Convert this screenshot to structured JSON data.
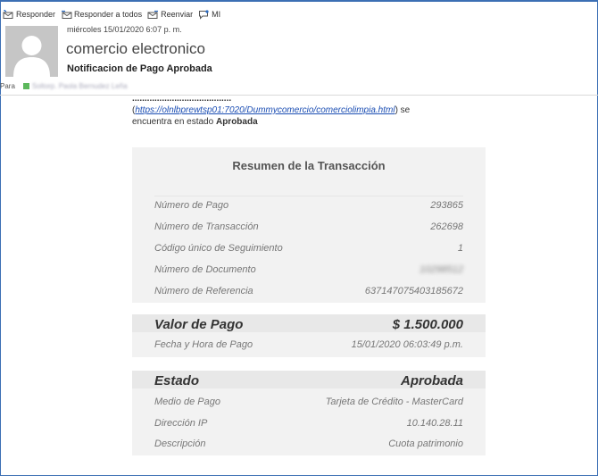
{
  "toolbar": {
    "reply": "Responder",
    "reply_all": "Responder a todos",
    "forward": "Reenviar",
    "im": "MI"
  },
  "header": {
    "date": "miércoles 15/01/2020 6:07 p. m.",
    "sender": "comercio electronico",
    "subject": "Notificacion de Pago Aprobada",
    "to_label": "Para",
    "recipient": "Soltorp. Paola Bernudez Leña"
  },
  "body": {
    "cut_text": "........................................",
    "paren_open": "(",
    "link": "https://olnlbprewtsp01:7020/Dummycomercio/comerciolimpia.html",
    "paren_close": ") se",
    "status_prefix": "encuentra en estado ",
    "status_word": "Aprobada"
  },
  "summary": {
    "title": "Resumen de la Transacción",
    "rows": [
      {
        "label": "Número de Pago",
        "value": "293865"
      },
      {
        "label": "Número de Transacción",
        "value": "262698"
      },
      {
        "label": "Código único de Seguimiento",
        "value": "1"
      },
      {
        "label": "Número de Documento",
        "value": "10298512"
      },
      {
        "label": "Número de Referencia",
        "value": "637147075403185672"
      }
    ]
  },
  "payment": {
    "label": "Valor de Pago",
    "value": "$ 1.500.000",
    "date_label": "Fecha y Hora de Pago",
    "date_value": "15/01/2020 06:03:49 p.m."
  },
  "estado": {
    "label": "Estado",
    "value": "Aprobada",
    "rows": [
      {
        "label": "Medio de Pago",
        "value": "Tarjeta de Crédito - MasterCard"
      },
      {
        "label": "Dirección IP",
        "value": "10.140.28.11"
      },
      {
        "label": "Descripción",
        "value": "Cuota patrimonio"
      }
    ]
  },
  "colors": {
    "frame": "#3c6fb4",
    "link": "#1a4db3",
    "panel": "#f2f2f2",
    "band": "#e8e8e8",
    "presence": "#5cb85c"
  }
}
